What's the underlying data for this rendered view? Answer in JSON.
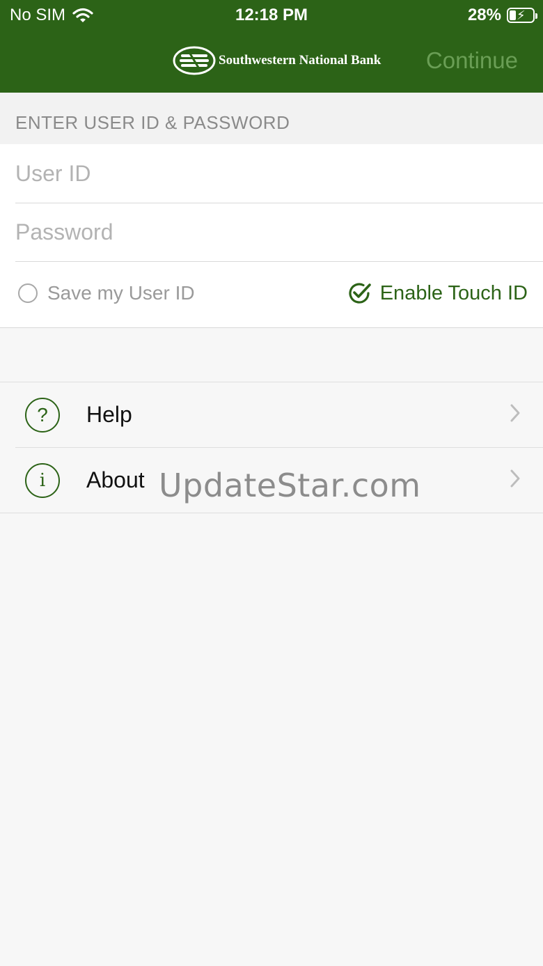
{
  "status_bar": {
    "carrier": "No SIM",
    "time": "12:18 PM",
    "battery": "28%",
    "battery_level": 0.28
  },
  "header": {
    "brand": "Southwestern National Bank",
    "continue_label": "Continue",
    "background_color": "#2c6317"
  },
  "login": {
    "section_title": "ENTER USER ID & PASSWORD",
    "user_id_placeholder": "User ID",
    "password_placeholder": "Password",
    "save_user_label": "Save my User ID",
    "save_user_checked": false,
    "touch_id_label": "Enable Touch ID",
    "touch_id_checked": true
  },
  "menu": {
    "items": [
      {
        "label": "Help",
        "icon": "question-circle-icon"
      },
      {
        "label": "About",
        "icon": "info-circle-icon"
      }
    ]
  },
  "watermark": "UpdateStar.com"
}
